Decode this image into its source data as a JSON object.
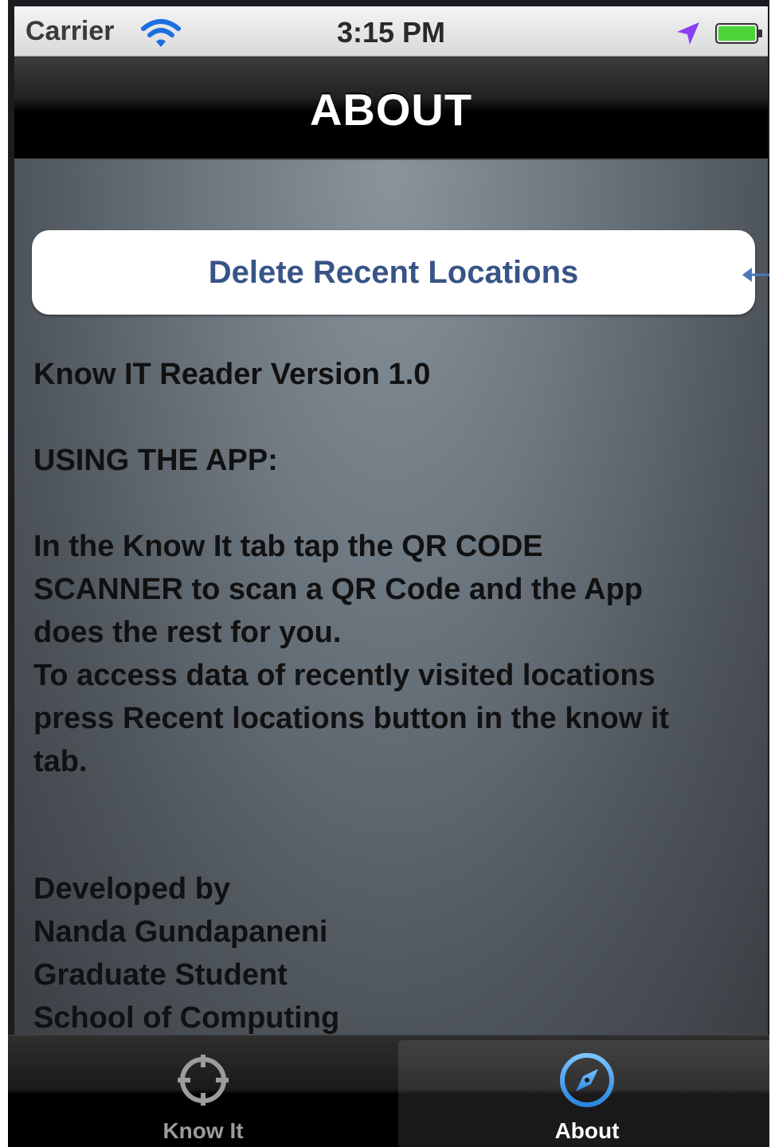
{
  "status_bar": {
    "carrier": "Carrier",
    "time": "3:15 PM",
    "icons": [
      "wifi-icon",
      "location-arrow-icon",
      "battery-icon"
    ]
  },
  "nav_bar": {
    "title": "ABOUT"
  },
  "content": {
    "delete_button_label": "Delete Recent Locations",
    "lines": [
      "Know IT Reader Version 1.0",
      " USING THE APP:",
      "In the Know It tab tap the QR CODE",
      "SCANNER to scan a QR Code and the App",
      "does the rest for you.",
      "To access data of recently visited locations",
      "press Recent locations button in the know it",
      "tab.",
      "Developed by",
      "Nanda Gundapaneni",
      "Graduate Student",
      "School of Computing"
    ]
  },
  "tab_bar": {
    "tabs": [
      {
        "label": "Know It",
        "icon": "crosshair-icon",
        "selected": false
      },
      {
        "label": "About",
        "icon": "compass-icon",
        "selected": true
      }
    ]
  },
  "colors": {
    "button_text": "#385487",
    "accent_blue": "#4a9be8",
    "location_arrow": "#8a3ff0",
    "battery_green": "#4cd43a"
  }
}
